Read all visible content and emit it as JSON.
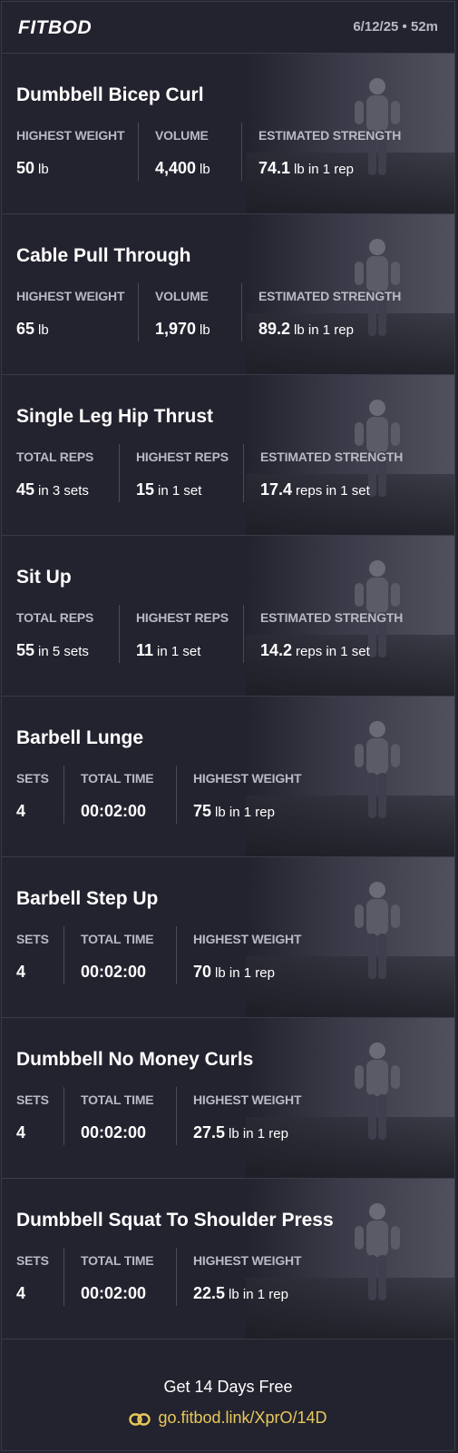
{
  "header": {
    "logo": "FITBOD",
    "meta": "6/12/25 • 52m"
  },
  "exercises": [
    {
      "title": "Dumbbell Bicep Curl",
      "stats": [
        {
          "label": "HIGHEST WEIGHT",
          "value": "50",
          "unit": "lb"
        },
        {
          "label": "VOLUME",
          "value": "4,400",
          "unit": "lb"
        },
        {
          "label": "ESTIMATED STRENGTH",
          "value": "74.1",
          "unit": "lb in 1 rep"
        }
      ]
    },
    {
      "title": "Cable Pull Through",
      "stats": [
        {
          "label": "HIGHEST WEIGHT",
          "value": "65",
          "unit": "lb"
        },
        {
          "label": "VOLUME",
          "value": "1,970",
          "unit": "lb"
        },
        {
          "label": "ESTIMATED STRENGTH",
          "value": "89.2",
          "unit": "lb in 1 rep"
        }
      ]
    },
    {
      "title": "Single Leg Hip Thrust",
      "stats": [
        {
          "label": "TOTAL REPS",
          "value": "45",
          "unit": "in 3 sets"
        },
        {
          "label": "HIGHEST REPS",
          "value": "15",
          "unit": "in 1 set"
        },
        {
          "label": "ESTIMATED STRENGTH",
          "value": "17.4",
          "unit": "reps in 1 set"
        }
      ]
    },
    {
      "title": "Sit Up",
      "stats": [
        {
          "label": "TOTAL REPS",
          "value": "55",
          "unit": "in 5 sets"
        },
        {
          "label": "HIGHEST REPS",
          "value": "11",
          "unit": "in 1 set"
        },
        {
          "label": "ESTIMATED STRENGTH",
          "value": "14.2",
          "unit": "reps in 1 set"
        }
      ]
    },
    {
      "title": "Barbell Lunge",
      "stats": [
        {
          "label": "SETS",
          "value": "4",
          "unit": ""
        },
        {
          "label": "TOTAL TIME",
          "value": "00:02:00",
          "unit": ""
        },
        {
          "label": "HIGHEST WEIGHT",
          "value": "75",
          "unit": "lb in 1 rep"
        }
      ]
    },
    {
      "title": "Barbell Step Up",
      "stats": [
        {
          "label": "SETS",
          "value": "4",
          "unit": ""
        },
        {
          "label": "TOTAL TIME",
          "value": "00:02:00",
          "unit": ""
        },
        {
          "label": "HIGHEST WEIGHT",
          "value": "70",
          "unit": "lb in 1 rep"
        }
      ]
    },
    {
      "title": "Dumbbell No Money Curls",
      "stats": [
        {
          "label": "SETS",
          "value": "4",
          "unit": ""
        },
        {
          "label": "TOTAL TIME",
          "value": "00:02:00",
          "unit": ""
        },
        {
          "label": "HIGHEST WEIGHT",
          "value": "27.5",
          "unit": "lb in 1 rep"
        }
      ]
    },
    {
      "title": "Dumbbell Squat To Shoulder Press",
      "stats": [
        {
          "label": "SETS",
          "value": "4",
          "unit": ""
        },
        {
          "label": "TOTAL TIME",
          "value": "00:02:00",
          "unit": ""
        },
        {
          "label": "HIGHEST WEIGHT",
          "value": "22.5",
          "unit": "lb in 1 rep"
        }
      ]
    }
  ],
  "footer": {
    "cta": "Get 14 Days Free",
    "link": "go.fitbod.link/XprO/14D",
    "link_icon": "link-icon"
  },
  "colors": {
    "background": "#23232f",
    "label": "#b9b9c6",
    "link": "#e7c85a"
  }
}
